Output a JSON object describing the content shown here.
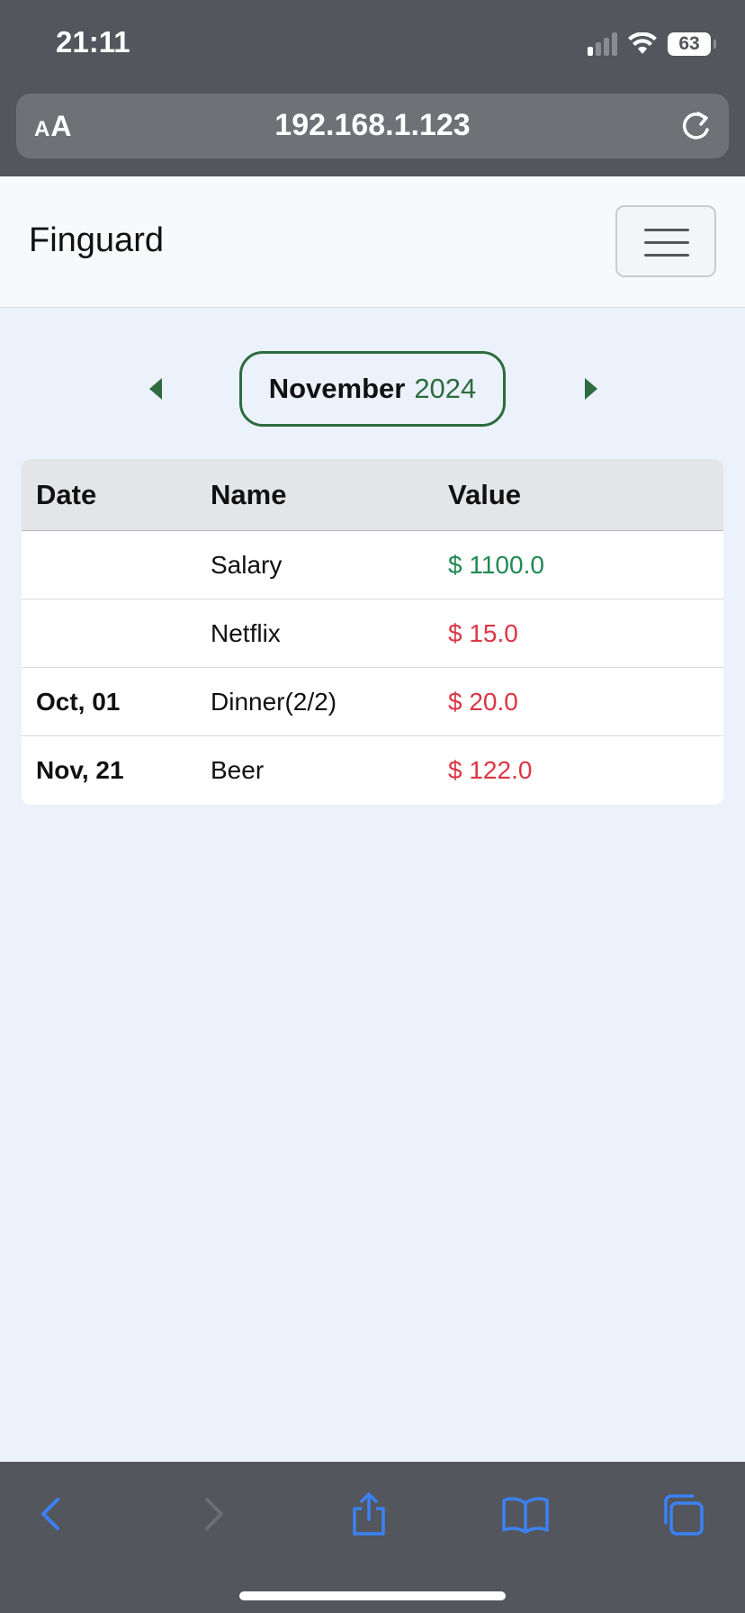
{
  "status_bar": {
    "time": "21:11",
    "battery": "63"
  },
  "browser": {
    "aa_small": "A",
    "aa_large": "A",
    "url": "192.168.1.123"
  },
  "navbar": {
    "brand": "Finguard"
  },
  "month_selector": {
    "month": "November",
    "year": "2024"
  },
  "table": {
    "headers": [
      "Date",
      "Name",
      "Value"
    ],
    "rows": [
      {
        "date": "",
        "name": "Salary",
        "value": "$ 1100.0",
        "type": "income"
      },
      {
        "date": "",
        "name": "Netflix",
        "value": "$ 15.0",
        "type": "expense"
      },
      {
        "date": "Oct, 01",
        "name": "Dinner(2/2)",
        "value": "$ 20.0",
        "type": "expense"
      },
      {
        "date": "Nov, 21",
        "name": "Beer",
        "value": "$ 122.0",
        "type": "expense"
      }
    ]
  },
  "colors": {
    "accent_green": "#2e6b3f",
    "income_green": "#1f8a52",
    "expense_red": "#dc3545",
    "chrome_blue": "#3b82f6"
  }
}
